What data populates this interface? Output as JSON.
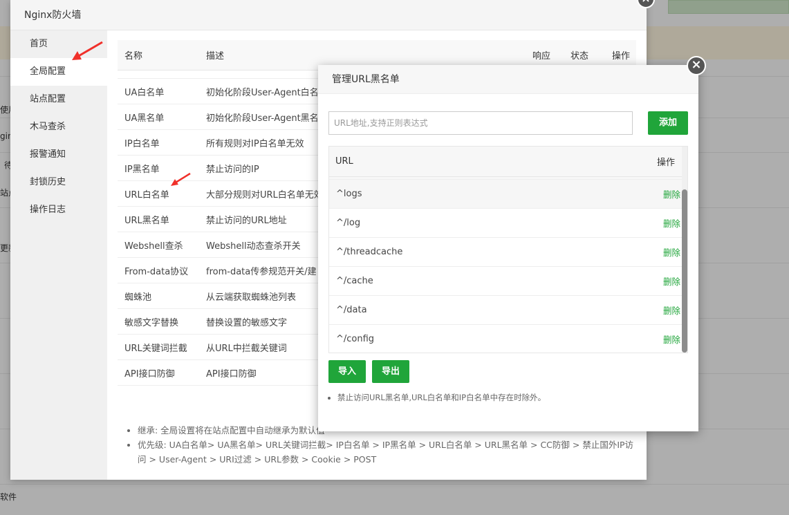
{
  "background": {
    "left_labels": [
      "使用",
      "gin",
      "待",
      "站点",
      "更新",
      "软件"
    ]
  },
  "main_modal": {
    "title": "Nginx防火墙",
    "close_symbol": "×",
    "side_menu": [
      {
        "label": "首页",
        "active": false
      },
      {
        "label": "全局配置",
        "active": true
      },
      {
        "label": "站点配置",
        "active": false
      },
      {
        "label": "木马查杀",
        "active": false
      },
      {
        "label": "报警通知",
        "active": false
      },
      {
        "label": "封锁历史",
        "active": false
      },
      {
        "label": "操作日志",
        "active": false
      }
    ],
    "table": {
      "headers": {
        "name": "名称",
        "desc": "描述",
        "resp": "响应",
        "status": "状态",
        "op": "操作"
      },
      "rows": [
        {
          "name": "UA白名单",
          "desc": "初始化阶段User-Agent白名"
        },
        {
          "name": "UA黑名单",
          "desc": "初始化阶段User-Agent黑名"
        },
        {
          "name": "IP白名单",
          "desc": "所有规则对IP白名单无效"
        },
        {
          "name": "IP黑名单",
          "desc": "禁止访问的IP"
        },
        {
          "name": "URL白名单",
          "desc": "大部分规则对URL白名单无效"
        },
        {
          "name": "URL黑名单",
          "desc": "禁止访问的URL地址"
        },
        {
          "name": "Webshell查杀",
          "desc": "Webshell动态查杀开关"
        },
        {
          "name": "From-data协议",
          "desc": "from-data传参规范开关/建"
        },
        {
          "name": "蜘蛛池",
          "desc": "从云端获取蜘蛛池列表"
        },
        {
          "name": "敏感文字替换",
          "desc": "替换设置的敏感文字"
        },
        {
          "name": "URL关键词拦截",
          "desc": "从URL中拦截关键词"
        },
        {
          "name": "API接口防御",
          "desc": "API接口防御"
        }
      ]
    },
    "notes": [
      "继承: 全局设置将在站点配置中自动继承为默认值",
      "优先级: UA白名单> UA黑名单> URL关键词拦截> IP白名单 > IP黑名单 > URL白名单 > URL黑名单 > CC防御 > 禁止国外IP访问 > User-Agent > URI过滤 > URL参数 > Cookie > POST"
    ]
  },
  "url_modal": {
    "title": "管理URL黑名单",
    "close_symbol": "×",
    "input_placeholder": "URL地址,支持正则表达式",
    "input_value": "",
    "add_label": "添加",
    "table_headers": {
      "url": "URL",
      "op": "操作"
    },
    "rows": [
      {
        "url": "^logs",
        "action": "删除"
      },
      {
        "url": "^/log",
        "action": "删除"
      },
      {
        "url": "^/threadcache",
        "action": "删除"
      },
      {
        "url": "^/cache",
        "action": "删除"
      },
      {
        "url": "^/data",
        "action": "删除"
      },
      {
        "url": "^/config",
        "action": "删除"
      }
    ],
    "import_label": "导入",
    "export_label": "导出",
    "note": "禁止访问URL黑名单,URL白名单和IP白名单中存在时除外。"
  },
  "colors": {
    "accent": "#20a53a",
    "arrow": "#f0302a"
  }
}
